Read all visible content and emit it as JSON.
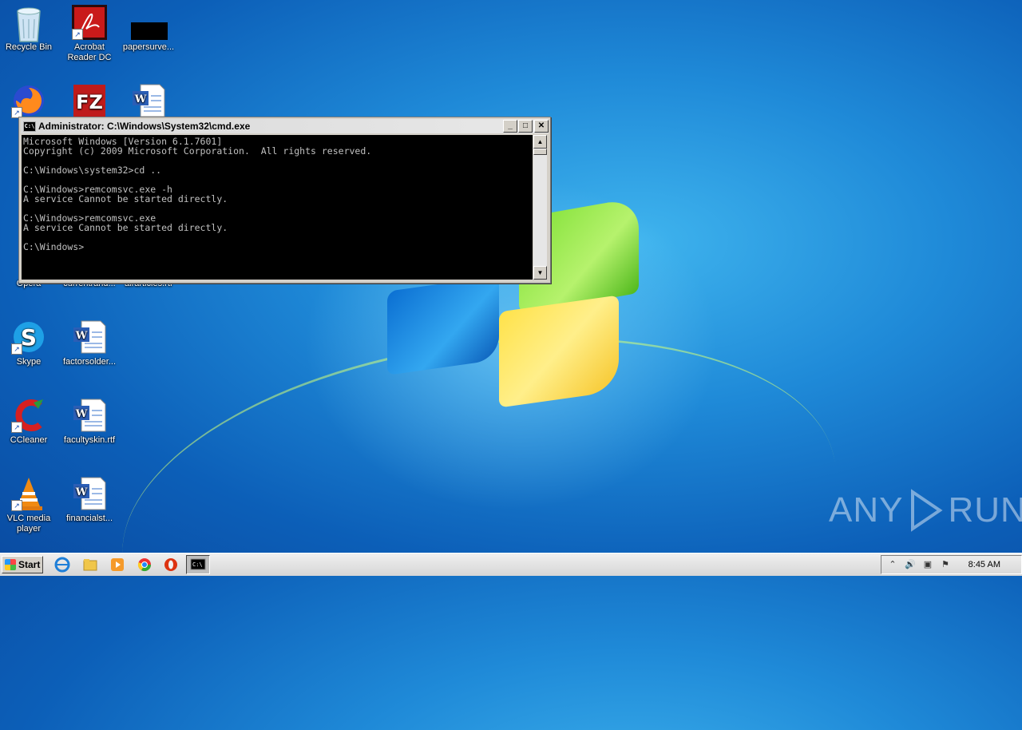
{
  "desktop": {
    "icons": [
      {
        "label": "Recycle Bin",
        "icon": "recycle-bin-icon"
      },
      {
        "label": "Acrobat\nReader DC",
        "icon": "acrobat-icon"
      },
      {
        "label": "papersurve...",
        "icon": "black-file-icon"
      },
      {
        "label": "",
        "icon": "firefox-icon"
      },
      {
        "label": "",
        "icon": "filezilla-icon"
      },
      {
        "label": "",
        "icon": "word-doc-icon"
      },
      {
        "label": "Opera",
        "icon": "opera-icon"
      },
      {
        "label": "currentrand...",
        "icon": "word-doc-icon"
      },
      {
        "label": "airarticles.rtf",
        "icon": "word-doc-icon"
      },
      {
        "label": "Skype",
        "icon": "skype-icon"
      },
      {
        "label": "factorsolder...",
        "icon": "word-doc-icon"
      },
      {
        "label": "CCleaner",
        "icon": "ccleaner-icon"
      },
      {
        "label": "facultyskin.rtf",
        "icon": "word-doc-icon"
      },
      {
        "label": "VLC media\nplayer",
        "icon": "vlc-icon"
      },
      {
        "label": "financialst...",
        "icon": "word-doc-icon"
      }
    ]
  },
  "cmd_window": {
    "title": "Administrator: C:\\Windows\\System32\\cmd.exe",
    "sys_icon_text": "C:\\",
    "buttons": {
      "minimize": "_",
      "maximize": "□",
      "close": "✕"
    },
    "output": "Microsoft Windows [Version 6.1.7601]\nCopyright (c) 2009 Microsoft Corporation.  All rights reserved.\n\nC:\\Windows\\system32>cd ..\n\nC:\\Windows>remcomsvc.exe -h\nA service Cannot be started directly.\n\nC:\\Windows>remcomsvc.exe\nA service Cannot be started directly.\n\nC:\\Windows>"
  },
  "watermark": {
    "left": "ANY",
    "right": "RUN"
  },
  "taskbar": {
    "start_label": "Start",
    "pinned": [
      "ie-icon",
      "explorer-icon",
      "media-player-icon",
      "chrome-icon",
      "opera-icon",
      "cmd-icon"
    ],
    "clock": "8:45 AM"
  }
}
